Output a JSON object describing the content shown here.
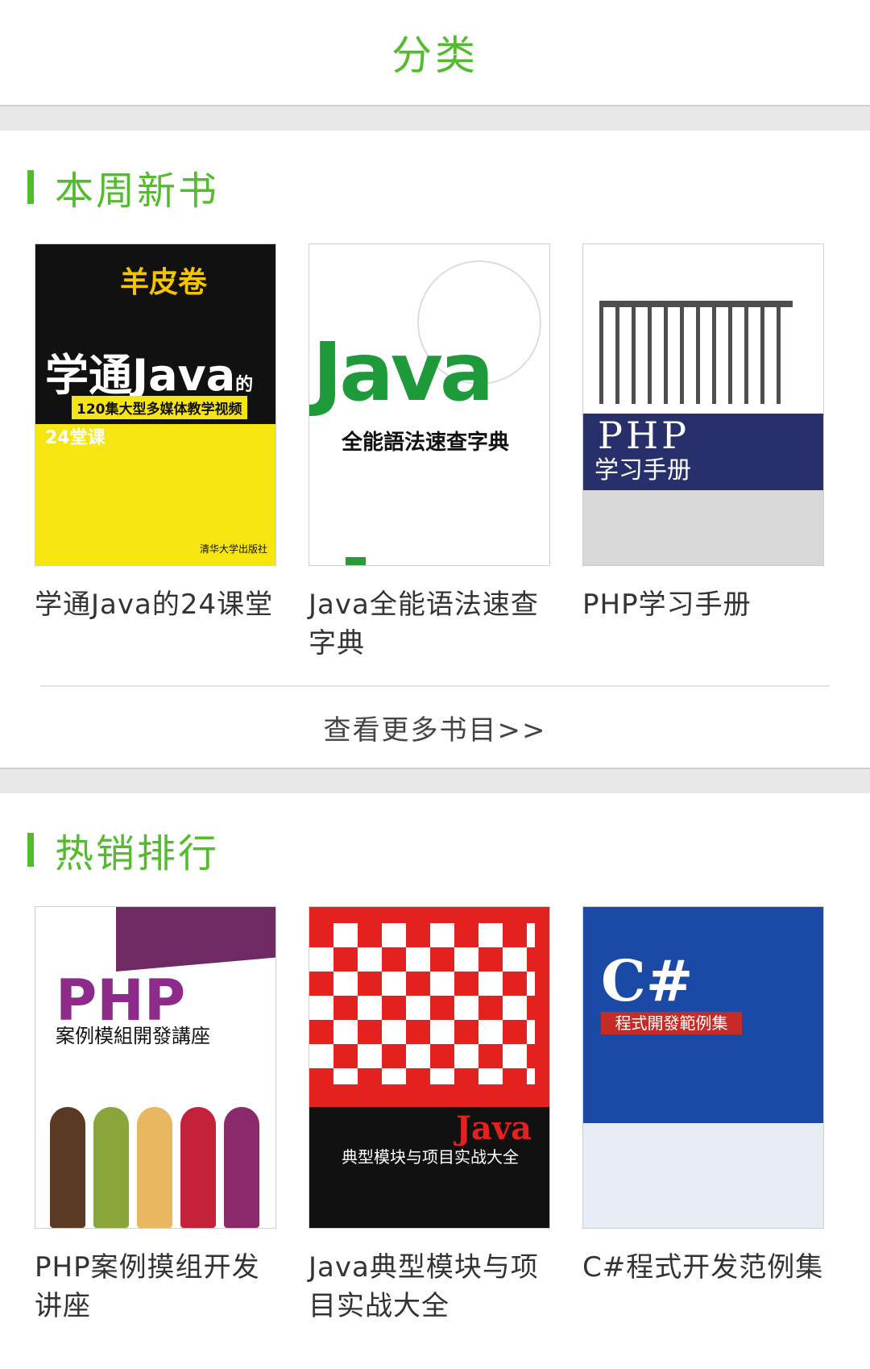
{
  "header": {
    "title": "分类"
  },
  "new_books": {
    "section_title": "本周新书",
    "books": [
      {
        "name": "学通Java的24课堂",
        "cover": {
          "logo": "羊皮卷",
          "title": "学通Java",
          "title_suffix": "的24堂课",
          "strip": "120集大型多媒体教学视频",
          "publisher": "清华大学出版社"
        }
      },
      {
        "name": "Java全能语法速查字典",
        "cover": {
          "title": "Java",
          "subtitle": "全能語法速查字典"
        }
      },
      {
        "name": "PHP学习手册",
        "cover": {
          "title": "PHP",
          "subtitle": "学习手册"
        }
      }
    ],
    "more_link": "查看更多书目>>"
  },
  "hot_books": {
    "section_title": "热销排行",
    "books": [
      {
        "name": "PHP案例摸组开发讲座",
        "cover": {
          "title": "PHP",
          "subtitle": "案例模組開發講座"
        }
      },
      {
        "name": "Java典型模块与项目实战大全",
        "cover": {
          "title": "Java",
          "subtitle": "典型模块与项目实战大全"
        }
      },
      {
        "name": "C#程式开发范例集",
        "cover": {
          "title": "C#",
          "subtitle": "程式開發範例集"
        }
      }
    ]
  },
  "colors": {
    "accent": "#55bb2e"
  }
}
